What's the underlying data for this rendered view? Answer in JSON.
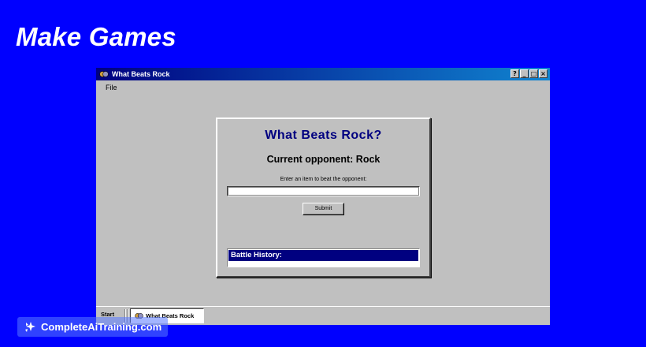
{
  "page": {
    "heading": "Make Games"
  },
  "window": {
    "title": "What Beats Rock",
    "buttons": {
      "help": "?",
      "minimize": "_",
      "maximize": "□",
      "close": "×"
    },
    "menu": [
      "File"
    ]
  },
  "dialog": {
    "title": "What Beats Rock?",
    "opponent_text": "Current opponent: Rock",
    "prompt": "Enter an item to beat the opponent:",
    "input_value": "",
    "submit_label": "Submit",
    "history_header": "Battle History:"
  },
  "taskbar": {
    "start_label": "Start",
    "item_label": "What Beats Rock"
  },
  "watermark": {
    "text": "CompleteAiTraining.com"
  },
  "colors": {
    "background": "#0000ff",
    "titlebar_start": "#000080",
    "titlebar_end": "#1084d0",
    "window_face": "#c0c0c0",
    "dialog_title": "#000080"
  }
}
